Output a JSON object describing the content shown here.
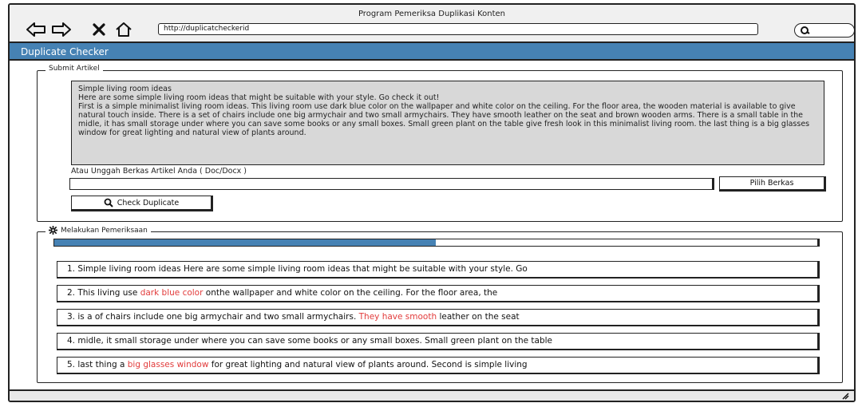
{
  "window": {
    "title": "Program Pemeriksa Duplikasi Konten"
  },
  "browser": {
    "url": "http://duplicatcheckerid",
    "icons": [
      "back-arrow-icon",
      "forward-arrow-icon",
      "close-icon",
      "home-icon",
      "search-icon"
    ]
  },
  "app": {
    "title": "Duplicate Checker",
    "accent_color": "#4682b4"
  },
  "submit": {
    "legend": "Submit Artikel",
    "article_lines": [
      "Simple living room ideas",
      "Here are some simple living room ideas that might be suitable with your style. Go check it out!",
      "First is a simple minimalist living room ideas. This living room use dark blue color on the wallpaper and white color on the ceiling. For the floor area, the wooden material is available to give natural touch inside. There is a set of chairs include one big armychair and two small armychairs. They have smooth leather on the seat and brown wooden arms. There is a small table in the midle, it has small storage under where you can save some books or any small boxes. Small green plant on the table give fresh look in this minimalist living room. the last thing is a big glasses window for great lighting and natural view of plants around."
    ],
    "upload_label": "Atau Unggah Berkas Artikel Anda ( Doc/Docx )",
    "file_value": "",
    "choose_file_label": "Pilih Berkas",
    "check_button_label": "Check Duplicate"
  },
  "checking": {
    "legend": "Melakukan Pemeriksaan",
    "progress_fraction": 0.5,
    "highlight_color": "#e23b3b",
    "results": [
      {
        "before": "1. Simple living room ideas Here are some simple living room ideas that might be suitable with your style. Go",
        "highlight": "",
        "after": ""
      },
      {
        "before": "2. This living use ",
        "highlight": "dark blue color",
        "after": "  onthe wallpaper and white color on the ceiling. For the floor area, the"
      },
      {
        "before": "3. is a of chairs include one big armychair and two small armychairs. ",
        "highlight": "They have smooth",
        "after": " leather on the seat"
      },
      {
        "before": "4. midle, it small storage under where you can save some books or any small boxes. Small green plant on the table",
        "highlight": "",
        "after": ""
      },
      {
        "before": "5. last thing a ",
        "highlight": "big glasses window",
        "after": " for great lighting and natural view of plants around. Second is simple living"
      }
    ]
  }
}
